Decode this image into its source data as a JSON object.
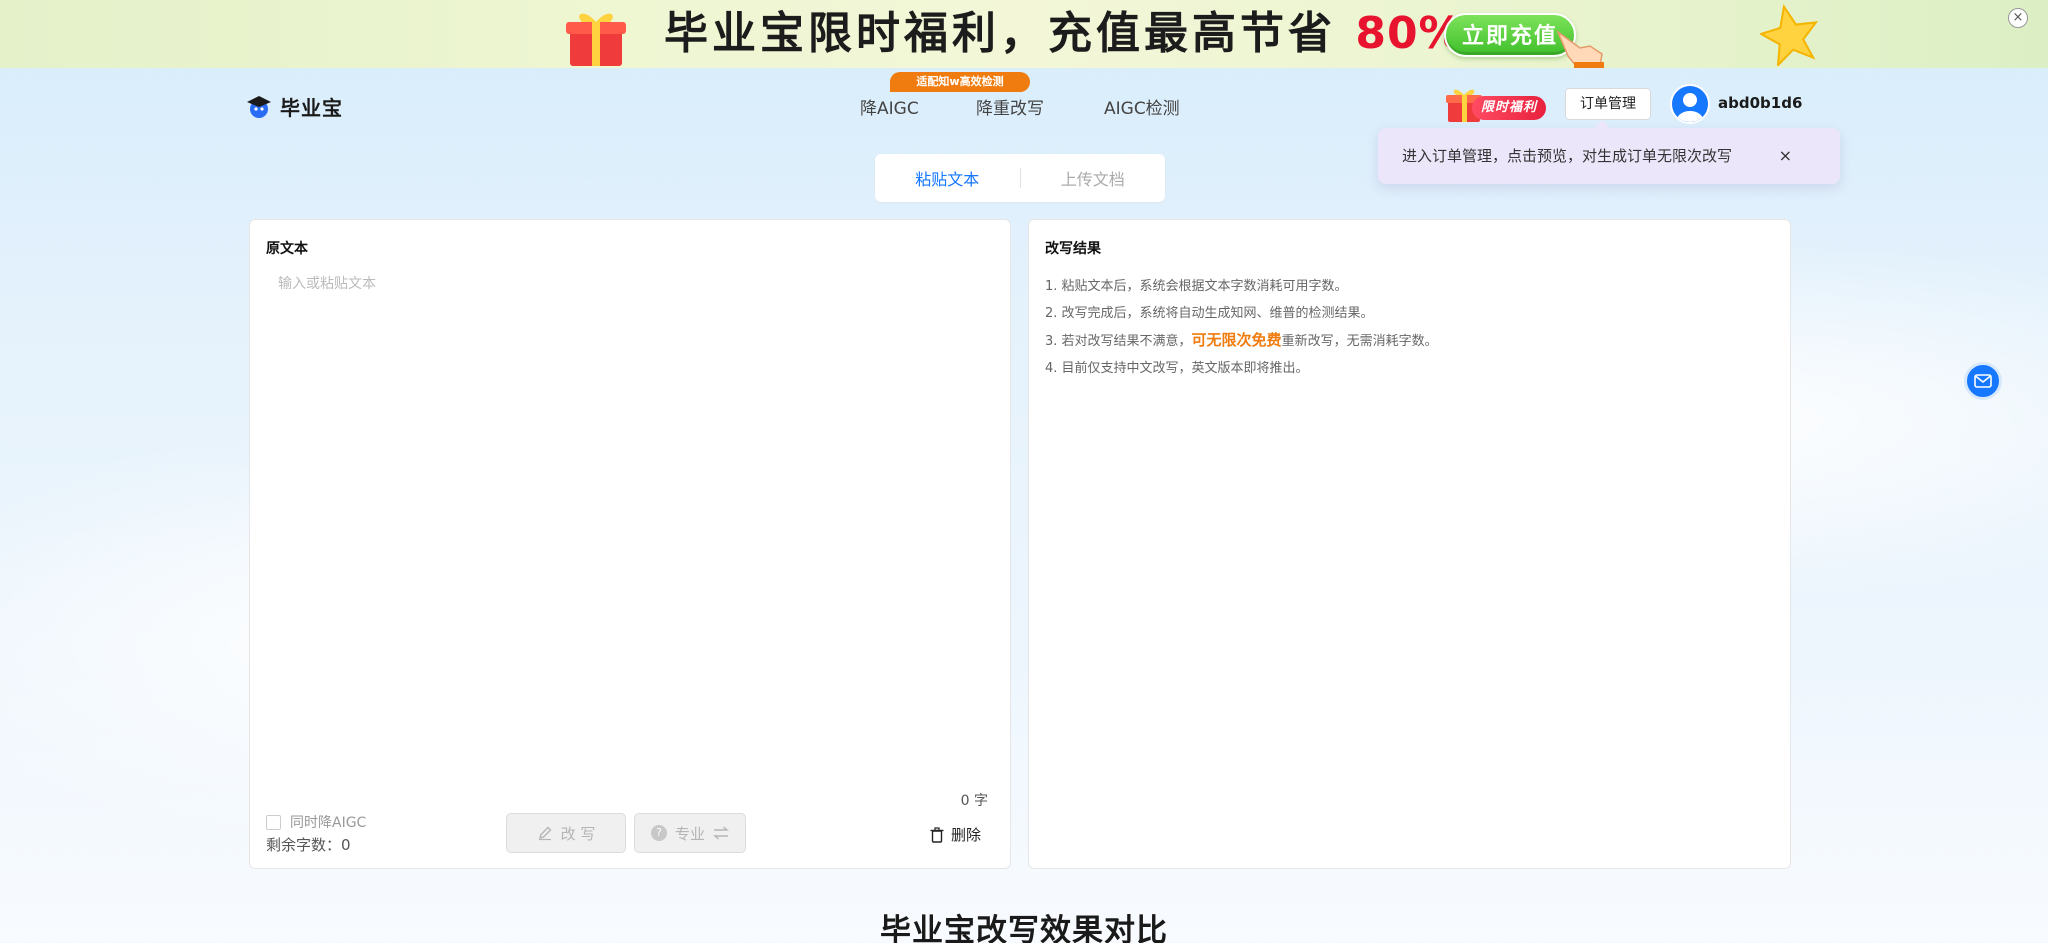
{
  "banner": {
    "headline": "毕业宝限时福利，充值最高节省",
    "percent": "80%",
    "cta": "立即充值",
    "close": "×"
  },
  "header": {
    "logo_text": "毕业宝",
    "nav": {
      "badge": "适配知w高效检测",
      "items": [
        "降AIGC",
        "降重改写",
        "AIGC检测"
      ]
    },
    "promo_pill": "限时福利",
    "order_button": "订单管理",
    "username": "abd0b1d6"
  },
  "tooltip": {
    "text": "进入订单管理，点击预览，对生成订单无限次改写",
    "close": "×"
  },
  "tabs": {
    "paste": "粘贴文本",
    "upload": "上传文档"
  },
  "original_panel": {
    "title": "原文本",
    "placeholder": "输入或粘贴文本",
    "word_count": "0 字",
    "same_aigc_label": "同时降AIGC",
    "remaining_label": "剩余字数：",
    "remaining_value": "0",
    "rewrite_button": "改 写",
    "pro_button": "专业",
    "delete_button": "删除"
  },
  "result_panel": {
    "title": "改写结果",
    "tips": [
      "1. 粘贴文本后，系统会根据文本字数消耗可用字数。",
      "2. 改写完成后，系统将自动生成知网、维普的检测结果。",
      "3. 若对改写结果不满意，",
      "4. 目前仅支持中文改写，英文版本即将推出。"
    ],
    "tip3_highlight": "可无限次免费",
    "tip3_suffix": "重新改写，无需消耗字数。"
  },
  "bottom": {
    "heading": "毕业宝改写效果对比"
  },
  "colors": {
    "accent": "#1677ff",
    "orange": "#f07c0f",
    "red": "#e8142f"
  }
}
